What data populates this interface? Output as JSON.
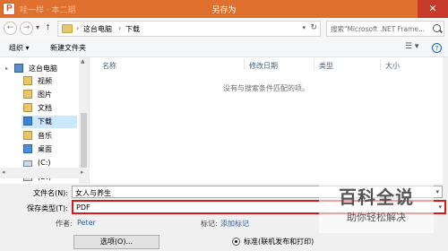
{
  "window": {
    "faded_title": "哇一样 · 本二期",
    "title": "另存为",
    "close_glyph": "✕"
  },
  "nav": {
    "back_glyph": "←",
    "forward_glyph": "→",
    "recent_glyph": "▾",
    "up_glyph": "↑"
  },
  "address": {
    "crumbs": [
      "这台电脑",
      "下载"
    ],
    "separator": "›",
    "dropdown_glyph": "▾",
    "refresh_glyph": "↻"
  },
  "search": {
    "placeholder": "搜索\"Microsoft .NET Frame..."
  },
  "toolbar": {
    "organize": "组织 ▾",
    "new_folder": "新建文件夹",
    "view_glyph": "☰ ▾",
    "help_glyph": "?"
  },
  "sidebar": {
    "items": [
      {
        "label": "这台电脑",
        "icon": "computer-icon"
      },
      {
        "label": "视频",
        "icon": "video-folder-icon"
      },
      {
        "label": "图片",
        "icon": "pictures-folder-icon"
      },
      {
        "label": "文档",
        "icon": "documents-folder-icon"
      },
      {
        "label": "下载",
        "icon": "downloads-folder-icon"
      },
      {
        "label": "音乐",
        "icon": "music-folder-icon"
      },
      {
        "label": "桌面",
        "icon": "desktop-folder-icon"
      },
      {
        "label": "(C:)",
        "icon": "drive-icon"
      },
      {
        "label": "(D:)",
        "icon": "drive-icon"
      }
    ],
    "expand_glyph": "▸",
    "scroll_up": "▲",
    "scroll_down": "▼",
    "hscroll_left": "◂",
    "hscroll_right": "▸"
  },
  "filelist": {
    "columns": [
      "名称",
      "修改日期",
      "类型",
      "大小"
    ],
    "empty_message": "没有与搜索条件匹配的项。"
  },
  "form": {
    "filename_label": "文件名(N):",
    "filename_value": "女人与养生",
    "type_label": "保存类型(T):",
    "type_value": "PDF",
    "dropdown_glyph": "▾",
    "author_label": "作者:",
    "author_value": "Peter",
    "tags_label": "标记:",
    "tags_value": "添加标记",
    "options_button": "选项(O)...",
    "optimize_option": "标准(联机发布和打印)"
  },
  "watermark": {
    "title": "百科全说",
    "subtitle": "助你轻松解决"
  },
  "colors": {
    "titlebar": "#e0702e",
    "highlight": "#d61a1a",
    "selection": "#cce8ff",
    "link": "#2f5ca6"
  }
}
